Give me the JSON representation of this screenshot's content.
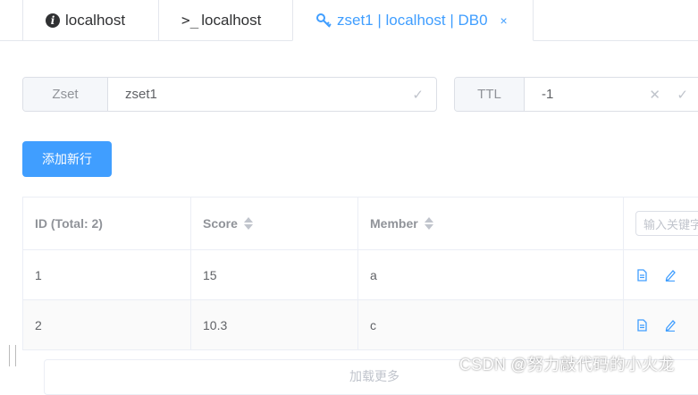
{
  "tabs": [
    {
      "label": "localhost",
      "icon": "info-icon"
    },
    {
      "label": "localhost",
      "icon": "terminal-icon"
    },
    {
      "label": "zset1 | localhost | DB0",
      "icon": "key-icon",
      "active": true,
      "close": "×"
    }
  ],
  "key_field": {
    "prefix": "Zset",
    "value": "zset1"
  },
  "ttl_field": {
    "prefix": "TTL",
    "value": "-1"
  },
  "add_button": "添加新行",
  "table": {
    "headers": {
      "id": "ID (Total: 2)",
      "score": "Score",
      "member": "Member"
    },
    "search_placeholder": "输入关键字",
    "rows": [
      {
        "id": "1",
        "score": "15",
        "member": "a"
      },
      {
        "id": "2",
        "score": "10.3",
        "member": "c"
      }
    ]
  },
  "load_more": "加载更多",
  "watermark": "CSDN @努力敲代码的小火龙",
  "colors": {
    "accent": "#409eff",
    "border": "#dcdfe6",
    "header_text": "#909399"
  }
}
